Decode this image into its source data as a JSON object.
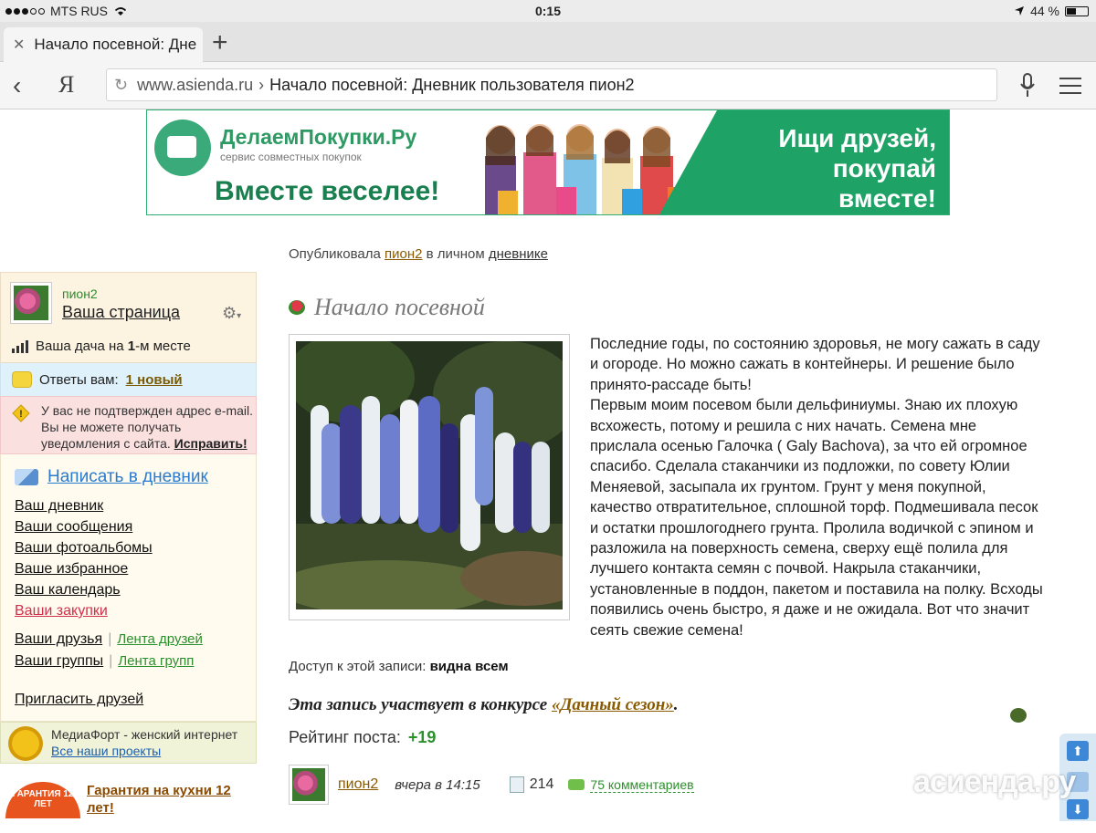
{
  "status_bar": {
    "carrier": "MTS RUS",
    "time": "0:15",
    "battery": "44 %",
    "battery_level": 0.44
  },
  "tab": {
    "title": "Начало посевной: Дне"
  },
  "address": {
    "domain": "www.asienda.ru",
    "separator": "›",
    "page_title": "Начало посевной: Дневник пользователя пион2"
  },
  "banner": {
    "brand": "ДелаемПокупки.Ру",
    "brand_sub": "сервис совместных покупок",
    "slogan": "Вместе веселее!",
    "cta_line1": "Ищи друзей,",
    "cta_line2": "покупай",
    "cta_line3": "вместе!"
  },
  "sidebar": {
    "username": "пион2",
    "your_page": "Ваша страница",
    "rank_pre": "Ваша дача на ",
    "rank_num": "1",
    "rank_post": "-м месте",
    "answers_label": "Ответы вам:",
    "answers_new": "1 новый",
    "warning_text": "У вас не подтвержден адрес e-mail. Вы не можете получать уведомления с сайта. ",
    "warning_fix": "Исправить!",
    "write_link": "Написать в дневник",
    "links": [
      "Ваш дневник",
      "Ваши сообщения",
      "Ваши фотоальбомы",
      "Ваше избранное",
      "Ваш календарь",
      "Ваши закупки"
    ],
    "friends": "Ваши друзья",
    "friends_feed": "Лента друзей",
    "groups": "Ваши группы",
    "groups_feed": "Лента групп",
    "invite": "Пригласить друзей",
    "mediafort_title": "МедиаФорт - женский интернет",
    "mediafort_link": "Все наши проекты",
    "promo_badge": "ГАРАНТИЯ 12 ЛЕТ",
    "promo_text": "Гарантия на кухни 12 лет!"
  },
  "post": {
    "published_pre": "Опубликовала ",
    "published_user": "пион2",
    "published_mid": " в личном ",
    "published_diary": "дневнике",
    "title": "Начало посевной",
    "text": "Последние годы, по состоянию здоровья, не могу сажать в саду и огороде. Но можно сажать в контейнеры. И решение было принято-рассаде быть!\nПервым моим посевом были дельфиниумы. Знаю их плохую всхожесть, потому и решила с них начать. Семена мне прислала осенью Галочка ( Galy Bachova), за что ей огромное спасибо. Сделала стаканчики из подложки, по совету Юлии Меняевой, засыпала их грунтом. Грунт у меня покупной, качество отвратительное, сплошной торф. Подмешивала песок и остатки прошлогоднего грунта. Пролила водичкой с эпином и разложила на поверхность семена, сверху ещё полила для лучшего контакта семян с почвой. Накрыла стаканчики, установленные в поддон, пакетом и поставила на полку. Всходы появились очень быстро, я даже и не ожидала. Вот что значит сеять свежие семена!",
    "access_label": "Доступ к этой записи: ",
    "access_value": "видна всем",
    "contest_pre": "Эта запись участвует в конкурсе ",
    "contest_link": "«Дачный сезон»",
    "contest_post": ".",
    "rating_label": "Рейтинг поста:",
    "rating_value": "+19",
    "author": "пион2",
    "time": "вчера в 14:15",
    "views": "214",
    "comments": "75 комментариев"
  },
  "watermark": "асиенда.ру",
  "colors": {
    "accent_green": "#2b8f2b",
    "link_brown": "#8a5a00",
    "banner_green": "#1fa266"
  }
}
